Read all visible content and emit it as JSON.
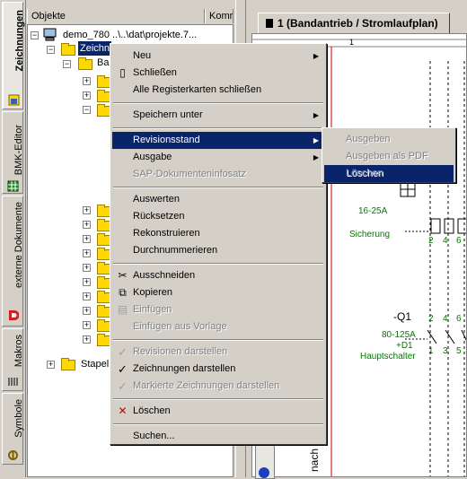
{
  "side_tabs": [
    {
      "label": "Zeichnungen",
      "active": true,
      "icon": "drawings-icon"
    },
    {
      "label": "BMK-Editor",
      "active": false,
      "icon": "bmk-grid-icon"
    },
    {
      "label": "externe Dokumente",
      "active": false,
      "icon": "pdf-doc-icon"
    },
    {
      "label": "Makros",
      "active": false,
      "icon": "macro-icon"
    },
    {
      "label": "Symbole",
      "active": false,
      "icon": "symbol-icon"
    }
  ],
  "tree": {
    "columns": [
      "Objekte",
      "Komr"
    ],
    "root": "demo_780 ..\\..\\dat\\projekte.7...",
    "selected": "Zeichn",
    "sub": "Ba",
    "last": "Stapel"
  },
  "document_tab": {
    "label": "1 (Bandantrieb / Stromlaufplan)"
  },
  "schematic": {
    "top_number": "1",
    "fuse_rating": "16-25A",
    "fuse_label": "Sicherung",
    "q1": "-Q1",
    "q1_rating": "80-125A",
    "q1_loc": "+D1",
    "q1_label": "Hauptschalter",
    "terminals_top": [
      "2",
      "4",
      "6"
    ],
    "terminals_bottom": [
      "1",
      "3",
      "5"
    ],
    "bottom_text": "nach"
  },
  "context_menu": {
    "groups": [
      [
        {
          "label": "Neu",
          "submenu": true
        },
        {
          "label": "Schließen",
          "icon": "close-doc-icon"
        },
        {
          "label": "Alle Registerkarten schließen"
        }
      ],
      [
        {
          "label": "Speichern unter",
          "submenu": true
        }
      ],
      [
        {
          "label": "Revisionsstand",
          "submenu": true,
          "selected": true
        },
        {
          "label": "Ausgabe",
          "submenu": true
        },
        {
          "label": "SAP-Dokumenteninfosatz",
          "disabled": true
        }
      ],
      [
        {
          "label": "Auswerten"
        },
        {
          "label": "Rücksetzen"
        },
        {
          "label": "Rekonstruieren"
        },
        {
          "label": "Durchnummerieren"
        }
      ],
      [
        {
          "label": "Ausschneiden",
          "icon": "scissors-icon"
        },
        {
          "label": "Kopieren",
          "icon": "copy-icon"
        },
        {
          "label": "Einfügen",
          "icon": "paste-icon",
          "disabled": true
        },
        {
          "label": "Einfügen aus Vorlage",
          "disabled": true
        }
      ],
      [
        {
          "label": "Revisionen darstellen",
          "checked": true,
          "disabled": true
        },
        {
          "label": "Zeichnungen darstellen",
          "checked": true
        },
        {
          "label": "Markierte Zeichnungen darstellen",
          "checked": true,
          "disabled": true
        }
      ],
      [
        {
          "label": "Löschen",
          "icon": "delete-x-icon"
        }
      ],
      [
        {
          "label": "Suchen..."
        }
      ]
    ]
  },
  "submenu": [
    {
      "label": "Ausgeben",
      "disabled": true
    },
    {
      "label": "Ausgeben als PDF",
      "disabled": true
    },
    {
      "label": "Löschen",
      "disabled": true,
      "selected": true
    }
  ],
  "colors": {
    "menu_highlight": "#0a246a",
    "schematic_green": "#007a00",
    "schematic_red": "#cc0000"
  }
}
